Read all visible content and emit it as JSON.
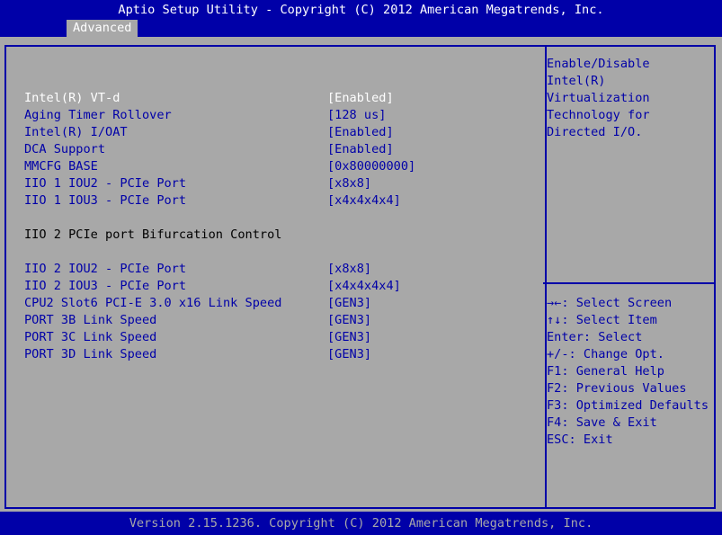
{
  "header": {
    "title": "Aptio Setup Utility - Copyright (C) 2012 American Megatrends, Inc.",
    "tabs": [
      {
        "label": "Advanced"
      }
    ]
  },
  "settings": [
    {
      "label": "Intel(R) VT-d",
      "value": "[Enabled]",
      "state": "selected"
    },
    {
      "label": "Aging Timer Rollover",
      "value": "[128 us]"
    },
    {
      "label": "Intel(R) I/OAT",
      "value": "[Enabled]"
    },
    {
      "label": "DCA Support",
      "value": "[Enabled]"
    },
    {
      "label": "MMCFG BASE",
      "value": "[0x80000000]"
    },
    {
      "label": "IIO 1 IOU2 - PCIe Port",
      "value": "[x8x8]"
    },
    {
      "label": "IIO 1 IOU3 - PCIe Port",
      "value": "[x4x4x4x4]"
    },
    {
      "label": "IIO 2 PCIe port Bifurcation Control",
      "value": "",
      "state": "static"
    },
    {
      "label": "IIO 2 IOU2 - PCIe Port",
      "value": "[x8x8]"
    },
    {
      "label": "IIO 2 IOU3 - PCIe Port",
      "value": "[x4x4x4x4]"
    },
    {
      "label": "CPU2 Slot6 PCI-E 3.0 x16 Link Speed",
      "value": "[GEN3]"
    },
    {
      "label": "PORT 3B Link Speed",
      "value": "[GEN3]"
    },
    {
      "label": "PORT 3C Link Speed",
      "value": "[GEN3]"
    },
    {
      "label": "PORT 3D Link Speed",
      "value": "[GEN3]"
    }
  ],
  "help": {
    "description": [
      "Enable/Disable",
      "Intel(R)",
      "Virtualization",
      "Technology for",
      "Directed I/O."
    ],
    "keys": [
      "→←: Select Screen",
      "↑↓: Select Item",
      "Enter: Select",
      "+/-: Change Opt.",
      "F1: General Help",
      "F2: Previous Values",
      "F3: Optimized Defaults",
      "F4: Save & Exit",
      "ESC: Exit"
    ]
  },
  "footer": {
    "version": "Version 2.15.1236. Copyright (C) 2012 American Megatrends, Inc."
  },
  "colors": {
    "background": "#0000a8",
    "panel": "#a8a8a8",
    "highlight": "#ffffff",
    "static_text": "#000000"
  }
}
